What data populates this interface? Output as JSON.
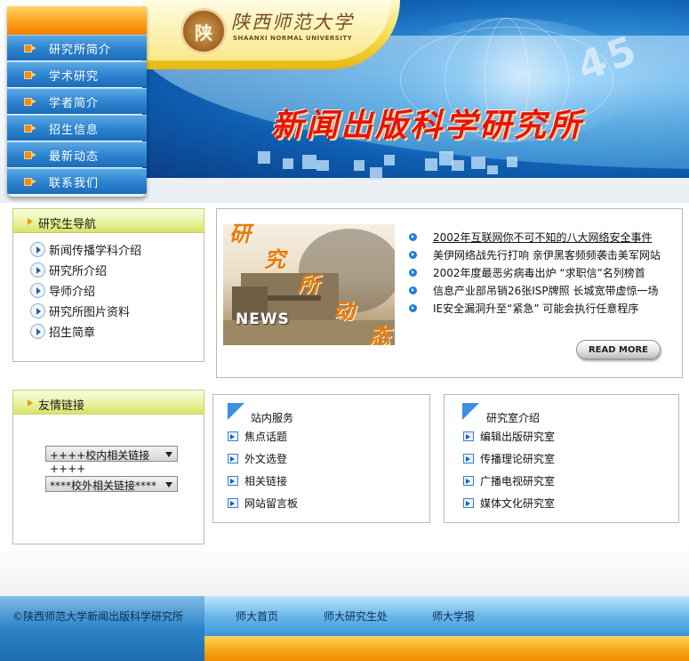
{
  "header": {
    "logo_char": "陕",
    "logo_name": "陕西师范大学",
    "logo_sub": "SHAANXI NORMAL UNIVERSITY",
    "site_title": "新闻出版科学研究所",
    "decor_numbers": "45"
  },
  "main_menu": {
    "items": [
      {
        "label": "研究所简介"
      },
      {
        "label": "学术研究"
      },
      {
        "label": "学者简介"
      },
      {
        "label": "招生信息"
      },
      {
        "label": "最新动态"
      },
      {
        "label": "联系我们"
      }
    ]
  },
  "grad_nav": {
    "title": "研究生导航",
    "items": [
      {
        "label": "新闻传播学科介绍"
      },
      {
        "label": "研究所介绍"
      },
      {
        "label": "导师介绍"
      },
      {
        "label": "研究所图片资料"
      },
      {
        "label": "招生简章"
      }
    ]
  },
  "friend_links": {
    "title": "友情链接",
    "select_internal": "++++校内相关链接++++",
    "select_external": "****校外相关链接****"
  },
  "news": {
    "photo_chars": [
      "研",
      "究",
      "所",
      "动",
      "态"
    ],
    "photo_word": "NEWS",
    "items": [
      {
        "label": "2002年互联网你不可不知的八大网络安全事件"
      },
      {
        "label": "美伊网络战先行打响 亲伊黑客频频袭击美军网站"
      },
      {
        "label": "2002年度最恶劣病毒出炉 “求职信”名列榜首"
      },
      {
        "label": "信息产业部吊销26张ISP牌照  长城宽带虚惊一场"
      },
      {
        "label": "IE安全漏洞升至“紧急” 可能会执行任意程序"
      }
    ],
    "read_more": "READ MORE"
  },
  "site_services": {
    "title": "站内服务",
    "items": [
      {
        "label": "焦点话题"
      },
      {
        "label": "外文选登"
      },
      {
        "label": "相关链接"
      },
      {
        "label": "网站留言板"
      }
    ]
  },
  "lab_intro": {
    "title": "研究室介绍",
    "items": [
      {
        "label": "编辑出版研究室"
      },
      {
        "label": "传播理论研究室"
      },
      {
        "label": "广播电视研究室"
      },
      {
        "label": "媒体文化研究室"
      }
    ]
  },
  "footer": {
    "copyright": "©陕西师范大学新闻出版科学研究所",
    "links": [
      {
        "label": "师大首页"
      },
      {
        "label": "师大研究生处"
      },
      {
        "label": "师大学报"
      }
    ]
  },
  "colors": {
    "menu_blue": "#2f84cf",
    "menu_top_orange": "#ffa11b",
    "title_red": "#e8120c",
    "panel_header_yellow": "#e8f29a",
    "footer_orange": "#f7a715"
  },
  "icons": {
    "menu_item": "arrow-right-icon",
    "nav_item": "circle-play-icon",
    "news_item": "blue-bullet-icon",
    "service_item": "link-arrow-icon",
    "dropdown": "chevron-down-icon"
  }
}
